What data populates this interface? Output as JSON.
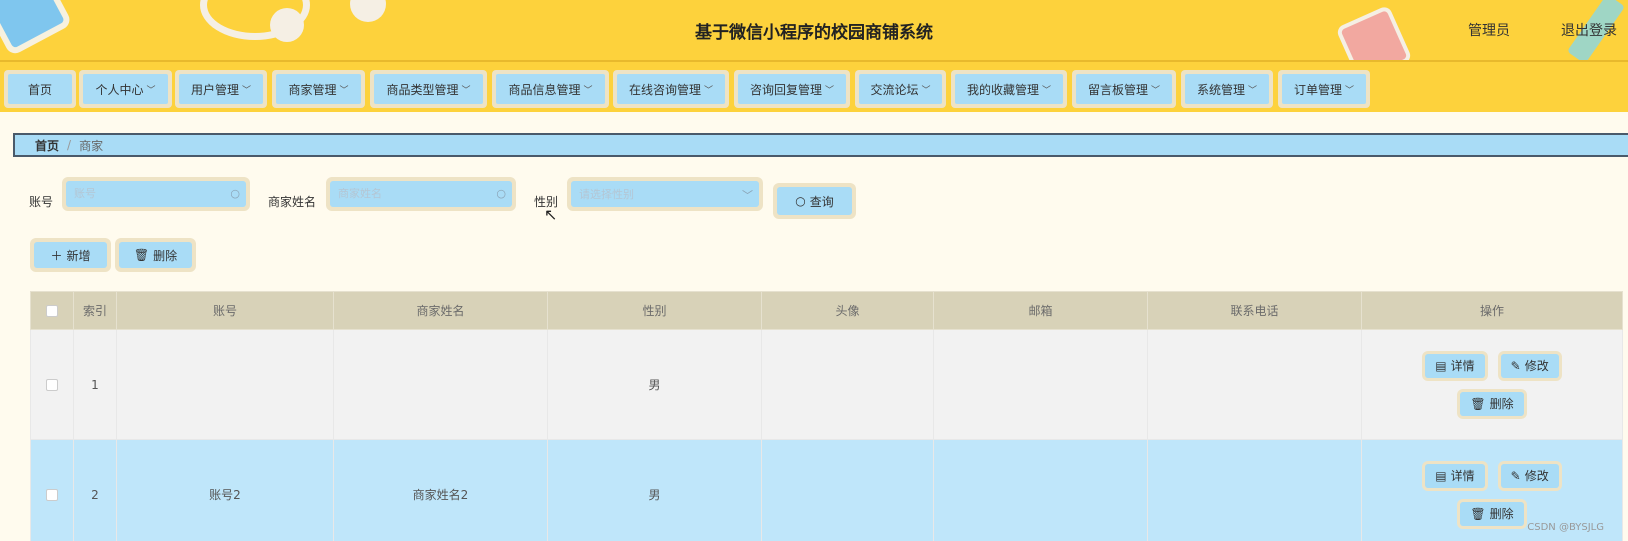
{
  "header": {
    "title": "基于微信小程序的校园商铺系统",
    "user": "管理员",
    "logout": "退出登录"
  },
  "nav": [
    {
      "label": "首页",
      "dropdown": false
    },
    {
      "label": "个人中心",
      "dropdown": true
    },
    {
      "label": "用户管理",
      "dropdown": true
    },
    {
      "label": "商家管理",
      "dropdown": true
    },
    {
      "label": "商品类型管理",
      "dropdown": true
    },
    {
      "label": "商品信息管理",
      "dropdown": true
    },
    {
      "label": "在线咨询管理",
      "dropdown": true
    },
    {
      "label": "咨询回复管理",
      "dropdown": true
    },
    {
      "label": "交流论坛",
      "dropdown": true
    },
    {
      "label": "我的收藏管理",
      "dropdown": true
    },
    {
      "label": "留言板管理",
      "dropdown": true
    },
    {
      "label": "系统管理",
      "dropdown": true
    },
    {
      "label": "订单管理",
      "dropdown": true
    }
  ],
  "breadcrumb": {
    "home": "首页",
    "sep": "/",
    "current": "商家"
  },
  "search": {
    "account_label": "账号",
    "account_placeholder": "账号",
    "name_label": "商家姓名",
    "name_placeholder": "商家姓名",
    "gender_label": "性别",
    "gender_placeholder": "请选择性别",
    "query_label": "查询"
  },
  "actions": {
    "add_label": "新增",
    "delete_label": "删除"
  },
  "table": {
    "headers": [
      "索引",
      "账号",
      "商家姓名",
      "性别",
      "头像",
      "邮箱",
      "联系电话",
      "操作"
    ],
    "rows": [
      {
        "index": "1",
        "account": "",
        "name": "",
        "gender": "男",
        "avatar": "",
        "email": "",
        "phone": ""
      },
      {
        "index": "2",
        "account": "账号2",
        "name": "商家姓名2",
        "gender": "男",
        "avatar": "",
        "email": "",
        "phone": ""
      }
    ],
    "op_detail": "详情",
    "op_edit": "修改",
    "op_delete": "删除"
  },
  "watermark": "CSDN @BYSJLG",
  "colors": {
    "header_bg": "#fdd23c",
    "button_bg": "#a9dcf6",
    "button_frame": "#eee3c5",
    "page_bg": "#fffbee",
    "row_selected": "#bfe6fa"
  }
}
